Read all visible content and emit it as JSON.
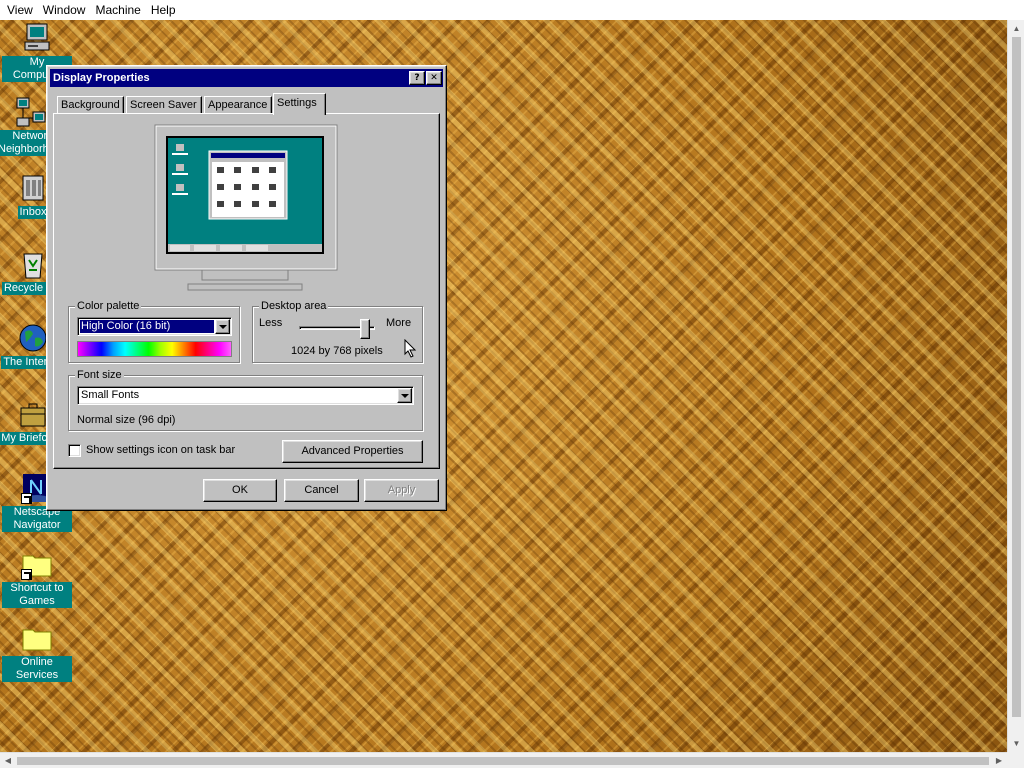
{
  "host": {
    "menu": [
      "View",
      "Window",
      "Machine",
      "Help"
    ]
  },
  "desktop": {
    "wallpaper_color": "#b2741c",
    "icons": [
      {
        "label": "My Computer",
        "icon": "computer-icon"
      },
      {
        "label": "Network Neighborhood",
        "icon": "network-icon"
      },
      {
        "label": "Inbox",
        "icon": "inbox-icon"
      },
      {
        "label": "Recycle Bin",
        "icon": "recycle-bin-icon"
      },
      {
        "label": "The Internet",
        "icon": "globe-icon"
      },
      {
        "label": "My Briefcase",
        "icon": "briefcase-icon"
      },
      {
        "label": "Netscape Navigator",
        "icon": "netscape-icon"
      },
      {
        "label": "Shortcut to Games",
        "icon": "folder-icon"
      },
      {
        "label": "Online Services",
        "icon": "folder-icon"
      }
    ]
  },
  "dialog": {
    "title": "Display Properties",
    "help_glyph": "?",
    "close_glyph": "✕",
    "tabs": [
      "Background",
      "Screen Saver",
      "Appearance",
      "Settings"
    ],
    "active_tab": "Settings",
    "color_palette": {
      "label": "Color palette",
      "value": "High Color (16 bit)"
    },
    "desktop_area": {
      "label": "Desktop area",
      "less": "Less",
      "more": "More",
      "value_text": "1024 by 768 pixels",
      "slider_fraction": 0.92
    },
    "font_size": {
      "label": "Font size",
      "value": "Small Fonts",
      "description": "Normal size (96 dpi)"
    },
    "show_icon_checkbox": {
      "label": "Show settings icon on task bar",
      "checked": false
    },
    "advanced_button": "Advanced Properties",
    "ok_button": "OK",
    "cancel_button": "Cancel",
    "apply_button": "Apply",
    "title_bar_color": "#000080",
    "preview_screen_color": "#008080"
  }
}
